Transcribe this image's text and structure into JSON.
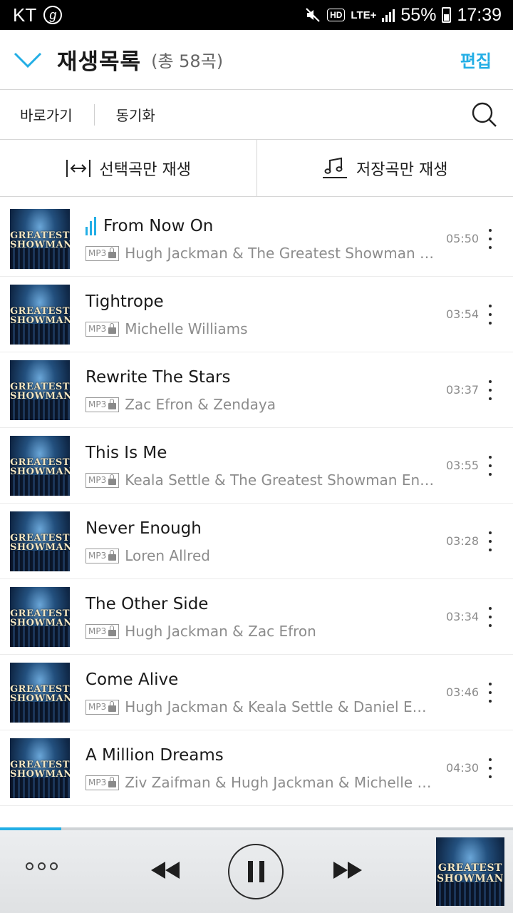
{
  "status_bar": {
    "carrier": "KT",
    "carrier_badge": "g",
    "hd_label": "HD",
    "network": "LTE+",
    "battery": "55%",
    "time": "17:39"
  },
  "header": {
    "title": "재생목록",
    "count": "(총 58곡)",
    "edit_label": "편집",
    "accent_color": "#23aee5"
  },
  "toolbar": {
    "goto_label": "바로가기",
    "sync_label": "동기화",
    "search_icon": "search-icon"
  },
  "filters": {
    "selected_label": "선택곡만 재생",
    "saved_label": "저장곡만 재생"
  },
  "album_art": {
    "line1": "GREATEST",
    "line2": "SHOWMAN"
  },
  "songs": [
    {
      "title": "From Now On",
      "format": "MP3",
      "artist": "Hugh Jackman & The Greatest Showman En...",
      "duration": "05:50",
      "playing": true
    },
    {
      "title": "Tightrope",
      "format": "MP3",
      "artist": "Michelle Williams",
      "duration": "03:54",
      "playing": false
    },
    {
      "title": "Rewrite The Stars",
      "format": "MP3",
      "artist": "Zac Efron & Zendaya",
      "duration": "03:37",
      "playing": false
    },
    {
      "title": "This Is Me",
      "format": "MP3",
      "artist": "Keala Settle & The Greatest Showman Ens...",
      "duration": "03:55",
      "playing": false
    },
    {
      "title": "Never Enough",
      "format": "MP3",
      "artist": "Loren Allred",
      "duration": "03:28",
      "playing": false
    },
    {
      "title": "The Other Side",
      "format": "MP3",
      "artist": "Hugh Jackman & Zac Efron",
      "duration": "03:34",
      "playing": false
    },
    {
      "title": "Come Alive",
      "format": "MP3",
      "artist": "Hugh Jackman & Keala Settle & Daniel Everi...",
      "duration": "03:46",
      "playing": false
    },
    {
      "title": "A Million Dreams",
      "format": "MP3",
      "artist": "Ziv Zaifman & Hugh Jackman & Michelle Willi...",
      "duration": "04:30",
      "playing": false
    }
  ],
  "player": {
    "progress": 0.12,
    "state": "playing"
  }
}
